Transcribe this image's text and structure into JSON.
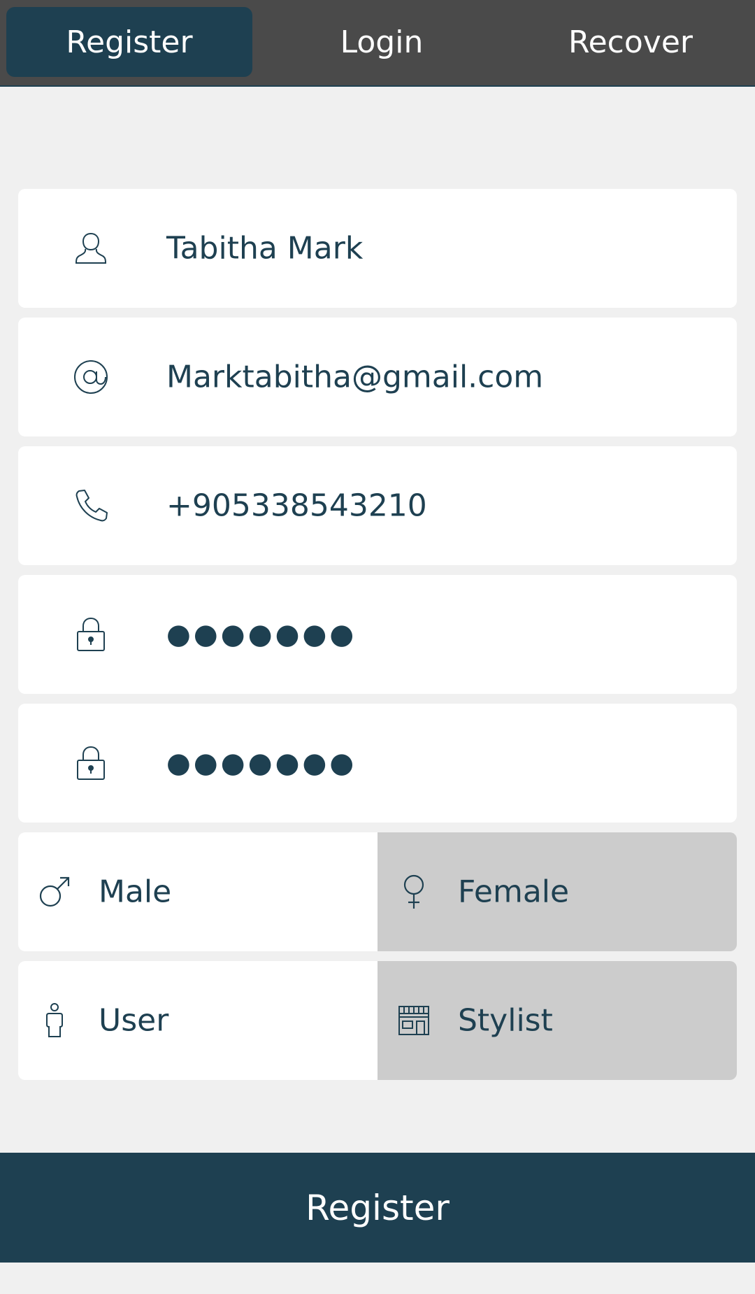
{
  "tabs": {
    "register": "Register",
    "login": "Login",
    "recover": "Recover"
  },
  "form": {
    "name": "Tabitha Mark",
    "email": "Marktabitha@gmail.com",
    "phone": "+905338543210",
    "password_mask": "●●●●●●●",
    "confirm_password_mask": "●●●●●●●"
  },
  "gender": {
    "male": "Male",
    "female": "Female",
    "selected": "female"
  },
  "account_type": {
    "user": "User",
    "stylist": "Stylist",
    "selected": "stylist"
  },
  "submit_label": "Register",
  "colors": {
    "primary": "#1e4051",
    "tabbar": "#4a4a4a",
    "background": "#f0f0f0",
    "selected_option": "#cccccc"
  }
}
